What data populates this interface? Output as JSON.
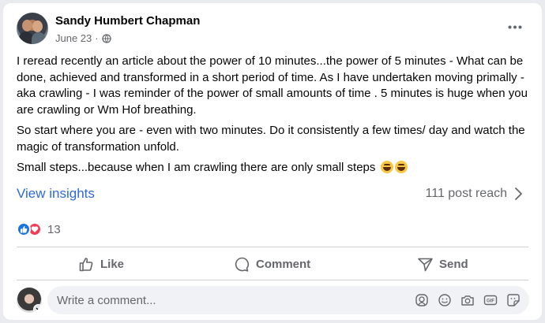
{
  "post": {
    "author": "Sandy Humbert Chapman",
    "date": "June 23",
    "separator": "·",
    "privacy_icon": "globe-icon",
    "more_icon": "more-horizontal-icon",
    "paragraphs": [
      "I reread recently an article about the power of 10 minutes...the power of 5 minutes - What can be done, achieved and transformed in a short period of time.  As I have undertaken moving primally - aka  crawling - I was reminder of the power of small amounts of time .  5 minutes is huge when you are crawling or Wm Hof breathing.",
      "So start where you are - even with two minutes.  Do it consistently a few times/ day and watch the magic of transformation unfold.",
      "Small steps...because when I am crawling there are only small steps"
    ],
    "emojis": [
      "grinning-squinting-face",
      "tears-of-joy-face"
    ]
  },
  "insights": {
    "link_label": "View insights",
    "reach": "111 post reach"
  },
  "reactions": {
    "types": [
      "like",
      "love"
    ],
    "count": "13"
  },
  "actions": {
    "like": "Like",
    "comment": "Comment",
    "send": "Send"
  },
  "composer": {
    "placeholder": "Write a comment...",
    "icons": [
      "avatar-sticker-icon",
      "emoji-icon",
      "camera-icon",
      "gif-icon",
      "sticker-icon"
    ]
  },
  "colors": {
    "link": "#2d6ad6",
    "like": "#1b74e4",
    "love": "#f33e58",
    "secondary_text": "#65676b"
  }
}
